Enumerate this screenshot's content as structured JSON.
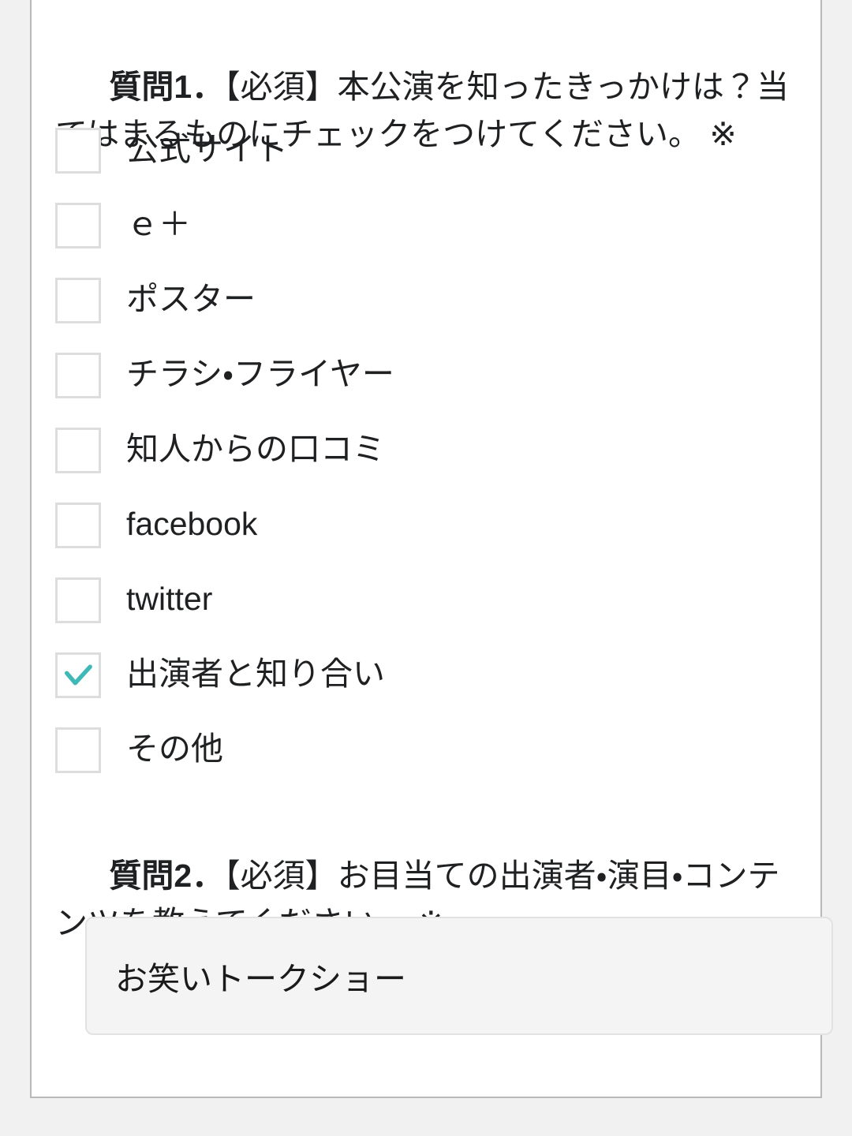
{
  "form": {
    "questions": [
      {
        "id": "q1",
        "number_label": "質問1．",
        "text": "【必須】本公演を知ったきっかけは？当てはまるものにチェックをつけてください。 ※",
        "type": "checkbox-group",
        "options": [
          {
            "label": "公式サイト",
            "checked": false,
            "script": "jp"
          },
          {
            "label": "ｅ＋",
            "checked": false,
            "script": "jp"
          },
          {
            "label": "ポスター",
            "checked": false,
            "script": "jp"
          },
          {
            "label": "チラシ・フライヤー",
            "checked": false,
            "script": "jp"
          },
          {
            "label": "知人からの口コミ",
            "checked": false,
            "script": "jp"
          },
          {
            "label": "facebook",
            "checked": false,
            "script": "latin"
          },
          {
            "label": "twitter",
            "checked": false,
            "script": "latin"
          },
          {
            "label": "出演者と知り合い",
            "checked": true,
            "script": "jp"
          },
          {
            "label": "その他",
            "checked": false,
            "script": "jp"
          }
        ]
      },
      {
        "id": "q2",
        "number_label": "質問2．",
        "text": "【必須】お目当ての出演者・演目・コンテンツを教えてください。 ※",
        "type": "text-input",
        "input": {
          "value": "お笑いトークショー",
          "placeholder": ""
        }
      }
    ]
  },
  "colors": {
    "page_background": "#f1f1f1",
    "card_background": "#ffffff",
    "card_border": "#b9b9b9",
    "text": "#1f2022",
    "checkbox_border": "#dddddd",
    "checkmark_accent": "#3fb8b8",
    "input_background": "#f4f4f4",
    "input_border": "#e2e2e2"
  },
  "icons": {
    "checkmark": "check-icon"
  }
}
